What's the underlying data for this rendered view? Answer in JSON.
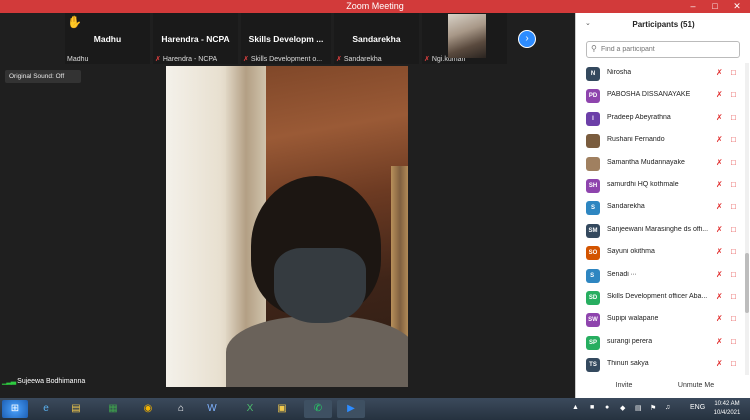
{
  "window": {
    "title": "Zoom Meeting"
  },
  "gallery": [
    {
      "name": "Madhu",
      "label": "Madhu",
      "muted": false
    },
    {
      "name": "Harendra - NCPA",
      "label": "Harendra - NCPA",
      "muted": true
    },
    {
      "name": "Skills  Developm ...",
      "label": "Skills Development  o...",
      "muted": true
    },
    {
      "name": "Sandarekha",
      "label": "Sandarekha",
      "muted": true
    },
    {
      "name": "",
      "label": "Ngi.kumari",
      "muted": true
    }
  ],
  "original_sound": "Original Sound: Off",
  "self_label": "Sujeewa Bodhimanna",
  "participants_panel": {
    "title": "Participants (51)",
    "search_placeholder": "Find a participant",
    "items": [
      {
        "initials": "N",
        "name": "Nirosha",
        "color": "#34495e"
      },
      {
        "initials": "PD",
        "name": "PABOSHA DISSANAYAKE",
        "color": "#8e44ad"
      },
      {
        "initials": "I",
        "name": "Pradeep Abeyrathna",
        "color": "#6c3fa8"
      },
      {
        "initials": "",
        "name": "Rushani Fernando",
        "color": "#7a5c3e"
      },
      {
        "initials": "",
        "name": "Samantha Mudannayake",
        "color": "#a08060"
      },
      {
        "initials": "SH",
        "name": "samurdhi HQ kothmale",
        "color": "#8e44ad"
      },
      {
        "initials": "S",
        "name": "Sandarekha",
        "color": "#2e86c1"
      },
      {
        "initials": "SM",
        "name": "Sanjeewani Marasinghe  ds offi...",
        "color": "#34495e"
      },
      {
        "initials": "SO",
        "name": "Sayuni okithma",
        "color": "#d35400"
      },
      {
        "initials": "S ",
        "name": "Senadi  ∙∙∙",
        "color": "#2e86c1"
      },
      {
        "initials": "SD",
        "name": "Skills Development  officer  Aba...",
        "color": "#27ae60"
      },
      {
        "initials": "SW",
        "name": "Supipi walapane",
        "color": "#8e44ad"
      },
      {
        "initials": "SP",
        "name": "surangi perera",
        "color": "#27ae60"
      },
      {
        "initials": "TS",
        "name": "Thinuri sakya",
        "color": "#34495e"
      }
    ],
    "invite_label": "Invite",
    "unmute_label": "Unmute Me"
  },
  "taskbar": {
    "language": "ENG",
    "time": "10:42 AM",
    "date": "10/4/2021",
    "apps": [
      "start",
      "ie",
      "explorer",
      "excel-green",
      "chrome",
      "home",
      "word",
      "excel",
      "folder",
      "whatsapp",
      "zoom"
    ]
  }
}
